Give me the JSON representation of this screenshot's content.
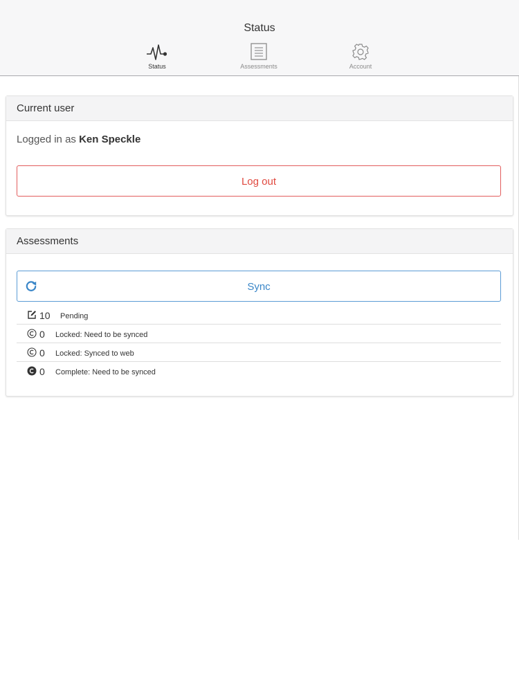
{
  "header": {
    "title": "Status",
    "tabs": [
      {
        "label": "Status",
        "icon": "pulse-icon",
        "active": true
      },
      {
        "label": "Assessments",
        "icon": "document-icon",
        "active": false
      },
      {
        "label": "Account",
        "icon": "gear-icon",
        "active": false
      }
    ]
  },
  "current_user": {
    "heading": "Current user",
    "logged_in_prefix": "Logged in as",
    "user_name": "Ken Speckle",
    "logout_label": "Log out"
  },
  "assessments": {
    "heading": "Assessments",
    "sync_label": "Sync",
    "rows": [
      {
        "icon": "edit-icon",
        "count": "10",
        "label": "Pending"
      },
      {
        "icon": "copyright-icon",
        "count": "0",
        "label": "Locked: Need to be synced"
      },
      {
        "icon": "copyright-icon",
        "count": "0",
        "label": "Locked: Synced to web"
      },
      {
        "icon": "complete-circle-icon",
        "count": "0",
        "label": "Complete: Need to be synced"
      }
    ]
  },
  "colors": {
    "danger": "#e0493f",
    "primary": "#3a86c8",
    "header_bg": "#f7f7f8"
  }
}
